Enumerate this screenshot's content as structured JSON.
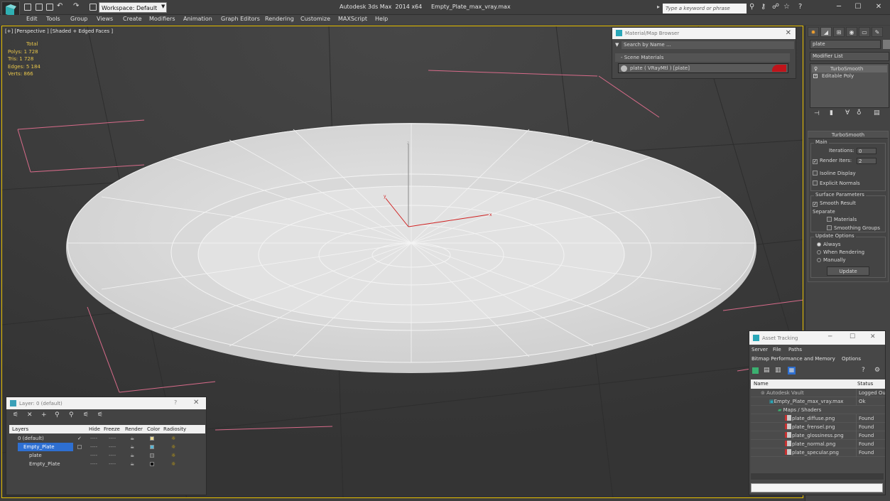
{
  "titlebar": {
    "workspace": "Workspace: Default",
    "app_title": "Autodesk 3ds Max  2014 x64",
    "file_name": "Empty_Plate_max_vray.max",
    "search_placeholder": "Type a keyword or phrase"
  },
  "menu": [
    "Edit",
    "Tools",
    "Group",
    "Views",
    "Create",
    "Modifiers",
    "Animation",
    "Graph Editors",
    "Rendering",
    "Customize",
    "MAXScript",
    "Help"
  ],
  "viewport": {
    "label": "[+] [Perspective ] [Shaded + Edged Faces ]",
    "stats": {
      "total_label": "Total",
      "polys": "Polys:  1 728",
      "tris": "Tris:   1 728",
      "edges": "Edges:  5 184",
      "verts": "Verts:  866"
    },
    "axes": {
      "x": "x",
      "y": "y",
      "z": "z"
    }
  },
  "material_browser": {
    "title": "Material/Map Browser",
    "search_placeholder": "Search by Name ...",
    "section": "- Scene Materials",
    "item": "plate  ( VRayMtl )  [plate]",
    "item_color": "#c0141b"
  },
  "command_panel": {
    "object_name": "plate",
    "modifier_list": "Modifier List",
    "stack": [
      "TurboSmooth",
      "Editable Poly"
    ],
    "turbosmooth": {
      "title": "TurboSmooth",
      "main_label": "Main",
      "iterations_label": "Iterations:",
      "iterations_value": "0",
      "render_iters_label": "Render Iters:",
      "render_iters_value": "2",
      "isoline": "Isoline Display",
      "explicit_normals": "Explicit Normals",
      "surface_params": "Surface Parameters",
      "smooth_result": "Smooth Result",
      "separate": "Separate",
      "materials": "Materials",
      "smoothing_groups": "Smoothing Groups",
      "update_options": "Update Options",
      "always": "Always",
      "when_rendering": "When Rendering",
      "manually": "Manually",
      "update_button": "Update"
    }
  },
  "layer_dialog": {
    "title": "Layer: 0 (default)",
    "help": "?",
    "columns": [
      "Layers",
      "Hide",
      "Freeze",
      "Render",
      "Color",
      "Radiosity"
    ],
    "rows": [
      {
        "name": "0 (default)",
        "color": "#e8d890",
        "indent": 0
      },
      {
        "name": "Empty_Plate",
        "color": "#5ab7d6",
        "indent": 0,
        "selected": true
      },
      {
        "name": "plate",
        "color": "#5a5a5a",
        "indent": 1
      },
      {
        "name": "Empty_Plate",
        "color": "#111111",
        "indent": 1
      }
    ],
    "cell_dash": "----"
  },
  "asset_tracking": {
    "title": "Asset Tracking",
    "menu_row1": [
      "Server",
      "File",
      "Paths"
    ],
    "menu_row2": [
      "Bitmap Performance and Memory",
      "Options"
    ],
    "columns": [
      "Name",
      "Status"
    ],
    "rows": [
      {
        "name": "Autodesk Vault",
        "status": "Logged Out",
        "indent": 1
      },
      {
        "name": "Empty_Plate_max_vray.max",
        "status": "Ok",
        "indent": 2
      },
      {
        "name": "Maps / Shaders",
        "status": "",
        "indent": 3
      },
      {
        "name": "plate_diffuse.png",
        "status": "Found",
        "indent": 4
      },
      {
        "name": "plate_frensel.png",
        "status": "Found",
        "indent": 4
      },
      {
        "name": "plate_glossiness.png",
        "status": "Found",
        "indent": 4
      },
      {
        "name": "plate_normal.png",
        "status": "Found",
        "indent": 4
      },
      {
        "name": "plate_specular.png",
        "status": "Found",
        "indent": 4
      }
    ]
  }
}
